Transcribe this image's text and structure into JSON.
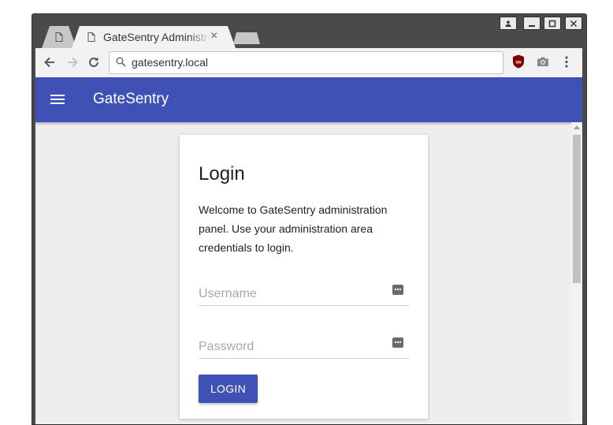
{
  "browser": {
    "active_tab": {
      "title": "GateSentry Administration Panel",
      "close_glyph": "×"
    },
    "address_bar": {
      "url": "gatesentry.local"
    },
    "window_controls": [
      "profile",
      "minimize",
      "maximize",
      "close"
    ],
    "extensions": [
      "ublock-origin-icon",
      "camera-icon",
      "menu-kebab-icon"
    ],
    "ublock_label": "uo"
  },
  "app": {
    "title": "GateSentry",
    "colors": {
      "primary": "#3f51b5",
      "background": "#eeeeee"
    }
  },
  "login": {
    "title": "Login",
    "description": "Welcome to GateSentry administration panel. Use your administration area credentials to login.",
    "username_placeholder": "Username",
    "password_placeholder": "Password",
    "button_label": "LOGIN"
  }
}
